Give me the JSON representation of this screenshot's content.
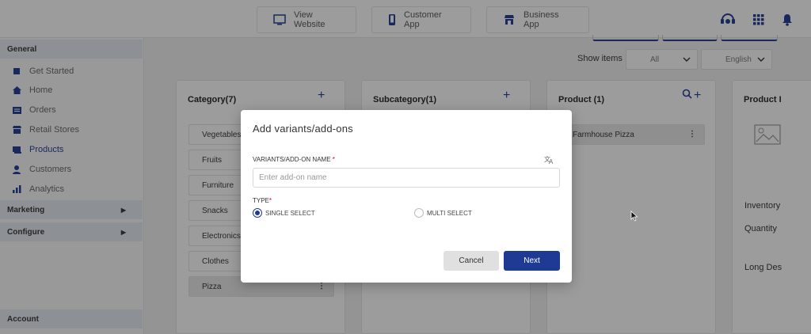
{
  "topbar": {
    "view_website": "View Website",
    "customer_app": "Customer App",
    "business_app": "Business App",
    "icons": [
      "support-icon",
      "apps-grid-icon",
      "bell-icon"
    ]
  },
  "sidebar": {
    "general_label": "General",
    "items": [
      {
        "label": "Get Started",
        "icon": "rocket-icon"
      },
      {
        "label": "Home",
        "icon": "home-icon"
      },
      {
        "label": "Orders",
        "icon": "orders-icon"
      },
      {
        "label": "Retail Stores",
        "icon": "store-icon"
      },
      {
        "label": "Products",
        "icon": "products-icon",
        "active": true
      },
      {
        "label": "Customers",
        "icon": "customers-icon"
      },
      {
        "label": "Analytics",
        "icon": "analytics-icon"
      }
    ],
    "marketing_label": "Marketing",
    "configure_label": "Configure",
    "account_label": "Account"
  },
  "filters": {
    "show_items_label": "Show items",
    "show_items_value": "All",
    "language_value": "English"
  },
  "category_panel": {
    "title": "Category(7)",
    "add": "+",
    "items": [
      "Vegetables",
      "Fruits",
      "Furniture",
      "Snacks",
      "Electronics",
      "Clothes",
      "Pizza"
    ],
    "selected": "Pizza"
  },
  "subcategory_panel": {
    "title": "Subcategory(1)",
    "add": "+"
  },
  "product_panel": {
    "title": "Product (1)",
    "items": [
      "Farmhouse Pizza"
    ]
  },
  "product_detail_panel": {
    "title": "Product I",
    "inventory_label": "Inventory",
    "quantity_label": "Quantity",
    "long_desc_label": "Long Des"
  },
  "modal": {
    "title": "Add variants/add-ons",
    "name_label": "VARIANTS/ADD-ON NAME",
    "required_mark": "*",
    "name_placeholder": "Enter add-on name",
    "name_value": "",
    "type_label": "TYPE",
    "single_select": "SINGLE SELECT",
    "multi_select": "MULTI SELECT",
    "selected_type": "SINGLE SELECT",
    "cancel": "Cancel",
    "next": "Next",
    "accent_color": "#1f3a93"
  }
}
